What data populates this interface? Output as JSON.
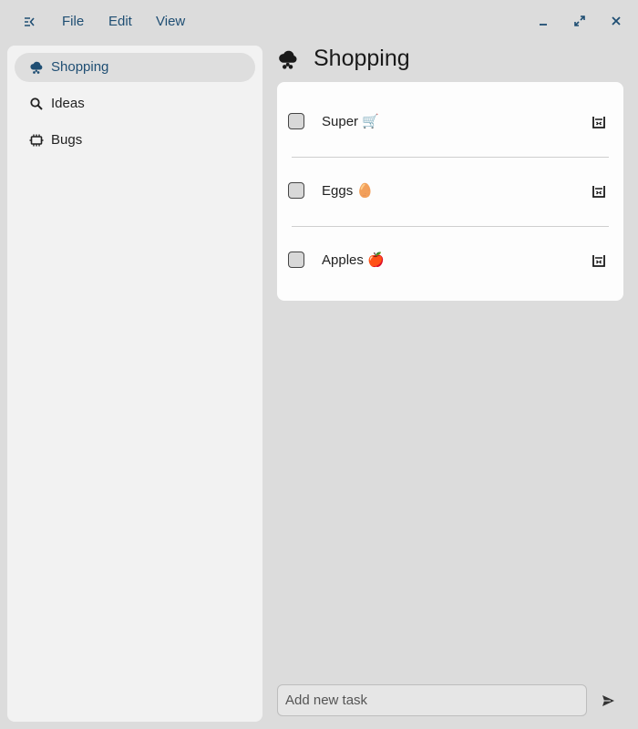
{
  "menu": {
    "items": [
      {
        "label": "File"
      },
      {
        "label": "Edit"
      },
      {
        "label": "View"
      }
    ]
  },
  "window_controls": [
    "minimize-icon",
    "maximize-icon",
    "close-icon"
  ],
  "sidebar": {
    "items": [
      {
        "label": "Shopping",
        "icon": "cloud-hail-icon",
        "active": true
      },
      {
        "label": "Ideas",
        "icon": "search-icon",
        "active": false
      },
      {
        "label": "Bugs",
        "icon": "chip-icon",
        "active": false
      }
    ]
  },
  "main": {
    "title": "Shopping",
    "title_icon": "cloud-hail-icon",
    "tasks": [
      {
        "label": "Super 🛒",
        "done": false
      },
      {
        "label": "Eggs 🥚",
        "done": false
      },
      {
        "label": "Apples 🍎",
        "done": false
      }
    ]
  },
  "composer": {
    "placeholder": "Add new task",
    "value": "",
    "send_icon": "send-icon"
  },
  "colors": {
    "accent": "#1f4e73",
    "background": "#dcdcdc",
    "sidebar": "#f2f2f2",
    "card": "#fdfdfd",
    "active_item": "#dedede"
  }
}
